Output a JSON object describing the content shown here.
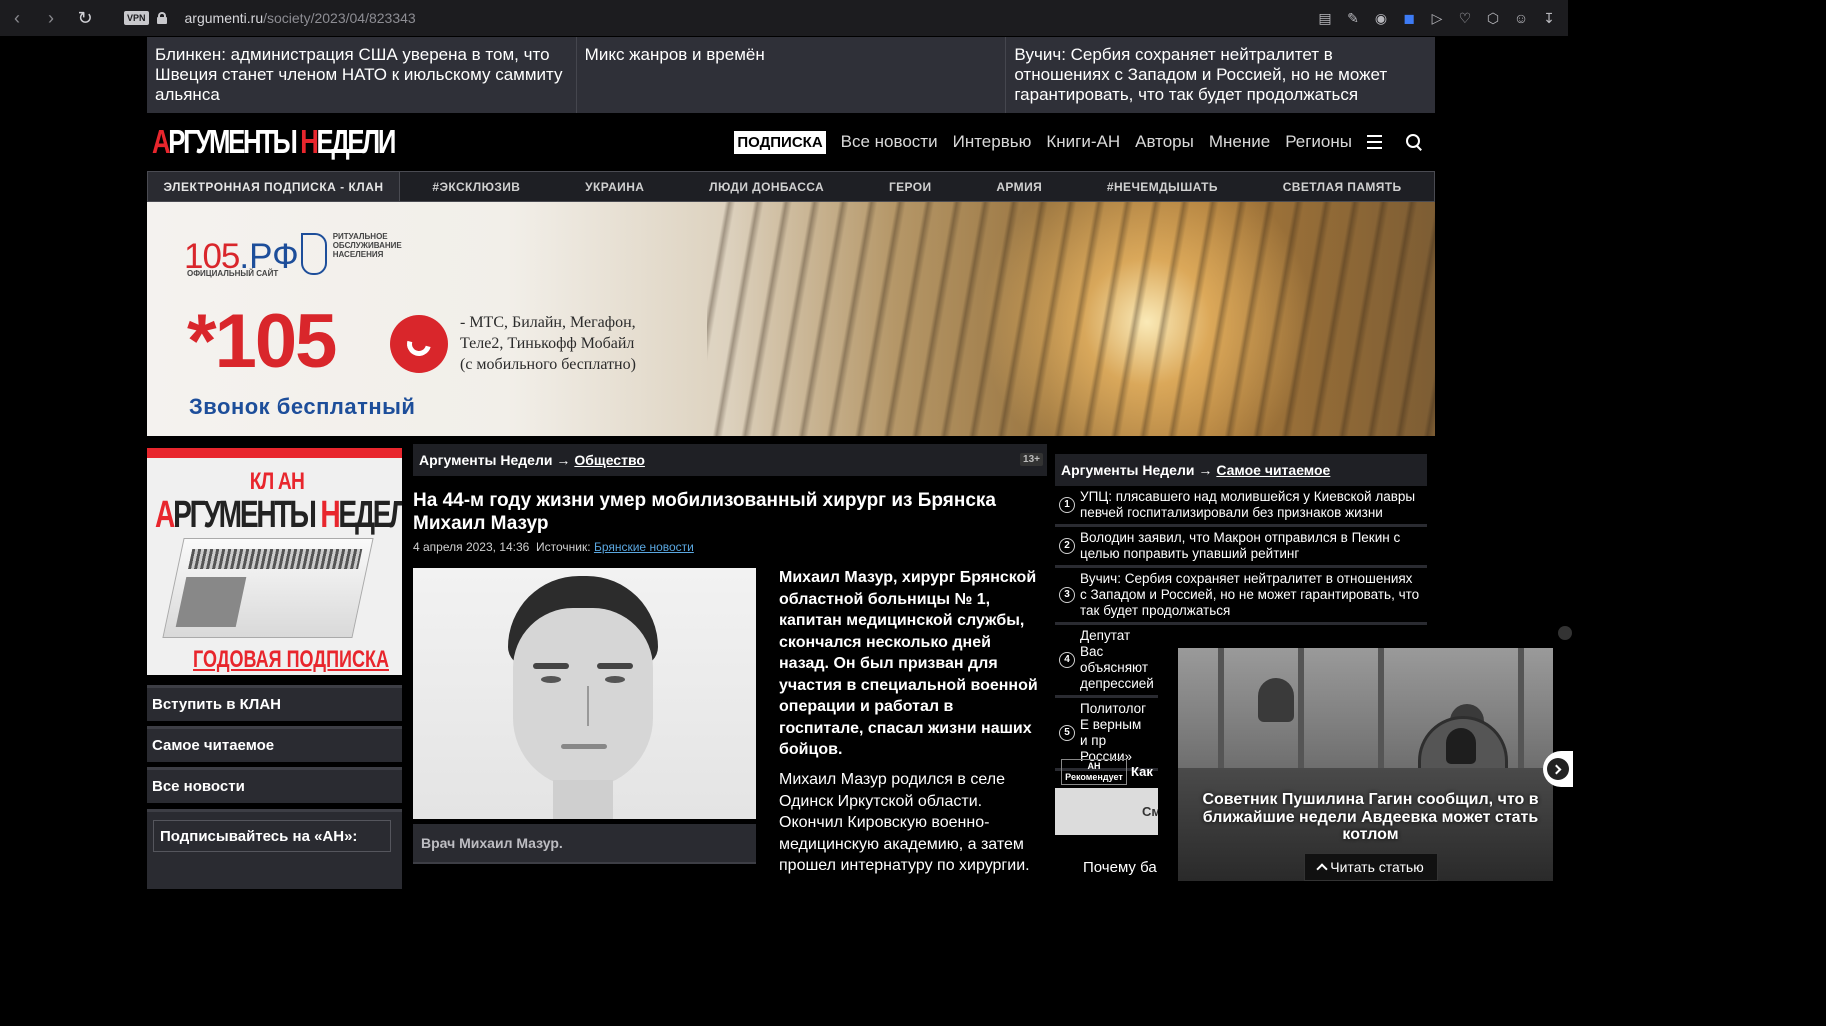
{
  "browser": {
    "vpn": "VPN",
    "url_host": "argumenti.ru",
    "url_path": "/society/2023/04/823343"
  },
  "ticker": [
    "Блинкен: администрация США уверена в том, что Швеция станет членом НАТО к июльскому саммиту альянса",
    "Микс жанров и времён",
    "Вучич: Сербия сохраняет нейтралитет в отношениях с Западом и Россией, но не может гарантировать, что так будет продолжаться"
  ],
  "logo": {
    "part1_red": "А",
    "part1": "РГУМЕНТЫ ",
    "part2_red": "Н",
    "part2": "ЕДЕЛИ"
  },
  "main_nav": {
    "subscribe": "ПОДПИСКА",
    "items": [
      "Все новости",
      "Интервью",
      "Книги-АН",
      "Авторы",
      "Мнение",
      "Регионы"
    ]
  },
  "section_nav": {
    "first": "ЭЛЕКТРОННАЯ ПОДПИСКА - КЛАН",
    "items": [
      "#ЭКСКЛЮЗИВ",
      "УКРАИНА",
      "ЛЮДИ ДОНБАССА",
      "ГЕРОИ",
      "АРМИЯ",
      "#НЕЧЕМДЫШАТЬ",
      "СВЕТЛАЯ ПАМЯТЬ"
    ]
  },
  "banner": {
    "logo_num": "105",
    "logo_rf": ".РФ",
    "logo_desc": [
      "РИТУАЛЬНОЕ",
      "ОБСЛУЖИВАНИЕ",
      "НАСЕЛЕНИЯ"
    ],
    "official": "ОФИЦИАЛЬНЫЙ САЙТ",
    "short_number": "*105",
    "operators": [
      "- МТС, Билайн, Мегафон,",
      "Теле2, Тинькофф Мобайл",
      "(с мобильного бесплатно)"
    ],
    "free_call": "Звонок бесплатный"
  },
  "left_sidebar": {
    "ad_klan": "КЛ АН",
    "ad_title_red1": "А",
    "ad_title1": "РГУМЕНТЫ ",
    "ad_title_red2": "Н",
    "ad_title2": "ЕДЕЛИ",
    "ad_annual": "ГОДОВАЯ ПОДПИСКА",
    "buttons": [
      "Вступить в КЛАН",
      "Самое читаемое",
      "Все новости"
    ],
    "subscribe_label": "Подписывайтесь на «АН»:"
  },
  "article": {
    "crumb_root": "Аргументы Недели →",
    "crumb_section": "Общество",
    "age": "13+",
    "title": "На 44-м году жизни умер мобилизованный хирург из Брянска Михаил Мазур",
    "date": "4 апреля 2023, 14:36",
    "source_label": "Источник:",
    "source": "Брянские новости",
    "photo_caption": "Врач Михаил Мазур.",
    "lead": "Михаил Мазур, хирург Брянской областной больницы № 1, капитан медицинской службы, скончался несколько дней назад. Он был призван для участия в специальной военной операции и работал в госпитале, спасал жизни наших бойцов.",
    "body": "Михаил Мазур родился в селе Одинск Иркутской области. Окончил Кировскую военно-медицинскую академию, а затем прошел интернатуру по хирургии."
  },
  "right_sidebar": {
    "crumb_root": "Аргументы Недели →",
    "crumb_section": "Самое читаемое",
    "popular": [
      {
        "n": "1",
        "text": "УПЦ: плясавшего над молившейся у Киевской лавры певчей госпитализировали без признаков жизни"
      },
      {
        "n": "2",
        "text": "Володин заявил, что Макрон отправился в Пекин с целью поправить упавший рейтинг"
      },
      {
        "n": "3",
        "text": "Вучич: Сербия сохраняет нейтралитет в отношениях с Западом и Россией, но не может гарантировать, что так будет продолжаться"
      },
      {
        "n": "4",
        "text": "Депутат Вас объясняют депрессией"
      },
      {
        "n": "5",
        "text": "Политолог Е верным и пр России»"
      }
    ],
    "rec_badge": [
      "АН",
      "Рекомендует"
    ],
    "rec_text": "Как",
    "grey_btn": "См",
    "why": "Почему ба"
  },
  "popup": {
    "headline": "Советник Пушилина Гагин сообщил, что в ближайшие недели Авдеевка может стать котлом",
    "read": "Читать статью"
  }
}
